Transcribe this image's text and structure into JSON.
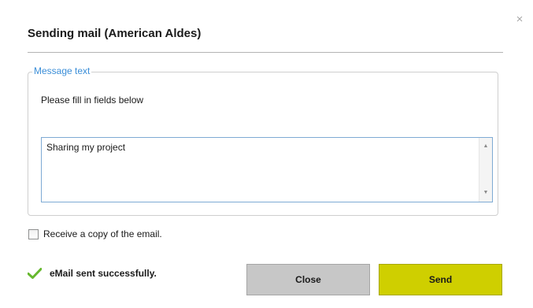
{
  "dialog": {
    "title": "Sending mail (American Aldes)",
    "close_icon": "×"
  },
  "message": {
    "legend": "Message text",
    "instructions": "Please fill in fields below",
    "textarea_value": "Sharing my project",
    "scroll_up_icon": "▲",
    "scroll_down_icon": "▼"
  },
  "copy": {
    "checked": false,
    "label": "Receive a copy of the email."
  },
  "status": {
    "icon": "check-icon",
    "text": "eMail sent successfully.",
    "color": "#66b82e"
  },
  "buttons": {
    "close_label": "Close",
    "send_label": "Send",
    "close_color": "#c7c7c7",
    "send_color": "#cfcf00"
  }
}
